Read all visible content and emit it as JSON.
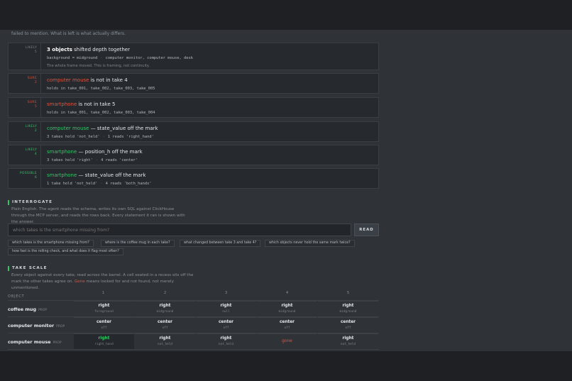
{
  "intro_text": "failed to mention. What is left is what actually differs.",
  "cards": [
    {
      "label": "LIKELY",
      "num": "5",
      "kind": "muted",
      "title_bold": "3 objects",
      "title_rest": " shifted depth together",
      "detail_a": "background = midground",
      "detail_b": "computer monitor, computer mouse, desk",
      "note": "The whole frame moved. This is framing, not continuity."
    },
    {
      "label": "SURE",
      "num": "2",
      "kind": "red",
      "object": "computer mouse",
      "title_rest": " is not in take 4",
      "detail_a": "holds in take_001, take_002, take_003, take_005"
    },
    {
      "label": "SURE",
      "num": "5",
      "kind": "red",
      "object": "smartphone",
      "title_rest": " is not in take 5",
      "detail_a": "holds in take_001, take_002, take_003, take_004"
    },
    {
      "label": "LIKELY",
      "num": "2",
      "kind": "green",
      "object": "computer mouse",
      "title_rest": " — state_value off the mark",
      "detail_a": "3 takes hold 'not_held'",
      "detail_b": "1 reads 'right_hand'"
    },
    {
      "label": "LIKELY",
      "num": "4",
      "kind": "green",
      "object": "smartphone",
      "title_rest": " — position_h off the mark",
      "detail_a": "3 takes hold 'right'",
      "detail_b": "4 reads 'center'"
    },
    {
      "label": "POSSIBLE",
      "num": "6",
      "kind": "green",
      "object": "smartphone",
      "title_rest": " — state_value off the mark",
      "detail_a": "1 take hold 'not_held'",
      "detail_b": "4 reads 'both_hands'"
    }
  ],
  "interrogate": {
    "heading": "INTERROGATE",
    "desc": "Plain English. The agent reads the schema, writes its own SQL against ClickHouse through the MCP server, and reads the rows back. Every statement it ran is shown with the answer.",
    "placeholder": "which takes is the smartphone missing from?",
    "button": "READ",
    "chips": [
      "which takes is the smartphone missing from?",
      "where is the coffee mug in each take?",
      "what changed between take 3 and take 4?",
      "which objects never hold the same mark twice?",
      "how fast is the rolling check, and what does it flag most often?"
    ]
  },
  "scale": {
    "heading": "TAKE SCALE",
    "desc_a": "Every object against every take, read across the barrel. A cell seated in a recess sits off the mark the other takes agree on. ",
    "desc_gone": "Gone",
    "desc_b": " means looked for and not found, not merely unmentioned.",
    "object_header": "OBJECT",
    "takes": [
      "1",
      "2",
      "3",
      "4",
      "5"
    ],
    "rows": [
      {
        "name": "coffee mug",
        "tag": "PROP",
        "cells": [
          {
            "v": "right",
            "s": "foreground"
          },
          {
            "v": "right",
            "s": "midground"
          },
          {
            "v": "right",
            "s": "null"
          },
          {
            "v": "right",
            "s": "midground"
          },
          {
            "v": "right",
            "s": "midground"
          }
        ]
      },
      {
        "name": "computer monitor",
        "tag": "PROP",
        "cells": [
          {
            "v": "center",
            "s": "off"
          },
          {
            "v": "center",
            "s": "off"
          },
          {
            "v": "center",
            "s": "off"
          },
          {
            "v": "center",
            "s": "off"
          },
          {
            "v": "center",
            "s": "off"
          }
        ]
      },
      {
        "name": "computer mouse",
        "tag": "PROP",
        "cells": [
          {
            "v": "right",
            "s": "right_hand",
            "flag": "green"
          },
          {
            "v": "right",
            "s": "not_held"
          },
          {
            "v": "right",
            "s": "not_held"
          },
          {
            "v": "gone",
            "s": "",
            "flag": "gone"
          },
          {
            "v": "right",
            "s": "not_held"
          }
        ]
      }
    ]
  }
}
